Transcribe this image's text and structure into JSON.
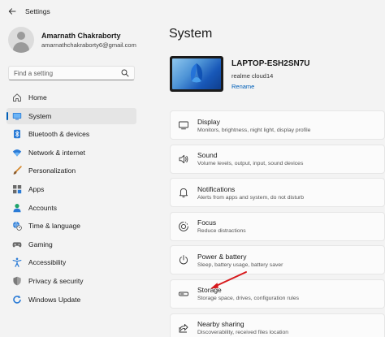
{
  "app": {
    "title": "Settings",
    "back_icon": "back-arrow-icon"
  },
  "profile": {
    "name": "Amarnath Chakraborty",
    "email": "amarnathchakraborty6@gmail.com"
  },
  "search": {
    "placeholder": "Find a setting"
  },
  "nav": {
    "items": [
      {
        "label": "Home",
        "icon": "home-icon",
        "active": false
      },
      {
        "label": "System",
        "icon": "monitor-icon",
        "active": true
      },
      {
        "label": "Bluetooth & devices",
        "icon": "bluetooth-icon",
        "active": false
      },
      {
        "label": "Network & internet",
        "icon": "wifi-icon",
        "active": false
      },
      {
        "label": "Personalization",
        "icon": "brush-icon",
        "active": false
      },
      {
        "label": "Apps",
        "icon": "apps-icon",
        "active": false
      },
      {
        "label": "Accounts",
        "icon": "person-icon",
        "active": false
      },
      {
        "label": "Time & language",
        "icon": "globe-clock-icon",
        "active": false
      },
      {
        "label": "Gaming",
        "icon": "gamepad-icon",
        "active": false
      },
      {
        "label": "Accessibility",
        "icon": "accessibility-icon",
        "active": false
      },
      {
        "label": "Privacy & security",
        "icon": "shield-icon",
        "active": false
      },
      {
        "label": "Windows Update",
        "icon": "update-icon",
        "active": false
      }
    ]
  },
  "main": {
    "title": "System",
    "device": {
      "name": "LAPTOP-ESH2SN7U",
      "model": "realme cloud14",
      "rename": "Rename"
    },
    "cards": [
      {
        "title": "Display",
        "subtitle": "Monitors, brightness, night light, display profile",
        "icon": "display-icon"
      },
      {
        "title": "Sound",
        "subtitle": "Volume levels, output, input, sound devices",
        "icon": "speaker-icon"
      },
      {
        "title": "Notifications",
        "subtitle": "Alerts from apps and system, do not disturb",
        "icon": "bell-icon"
      },
      {
        "title": "Focus",
        "subtitle": "Reduce distractions",
        "icon": "focus-icon"
      },
      {
        "title": "Power & battery",
        "subtitle": "Sleep, battery usage, battery saver",
        "icon": "power-icon"
      },
      {
        "title": "Storage",
        "subtitle": "Storage space, drives, configuration rules",
        "icon": "storage-icon"
      },
      {
        "title": "Nearby sharing",
        "subtitle": "Discoverability, received files location",
        "icon": "share-icon"
      }
    ]
  },
  "colors": {
    "accent": "#005fb8",
    "annotation_arrow": "#d7191c",
    "background": "#f3f3f3"
  }
}
